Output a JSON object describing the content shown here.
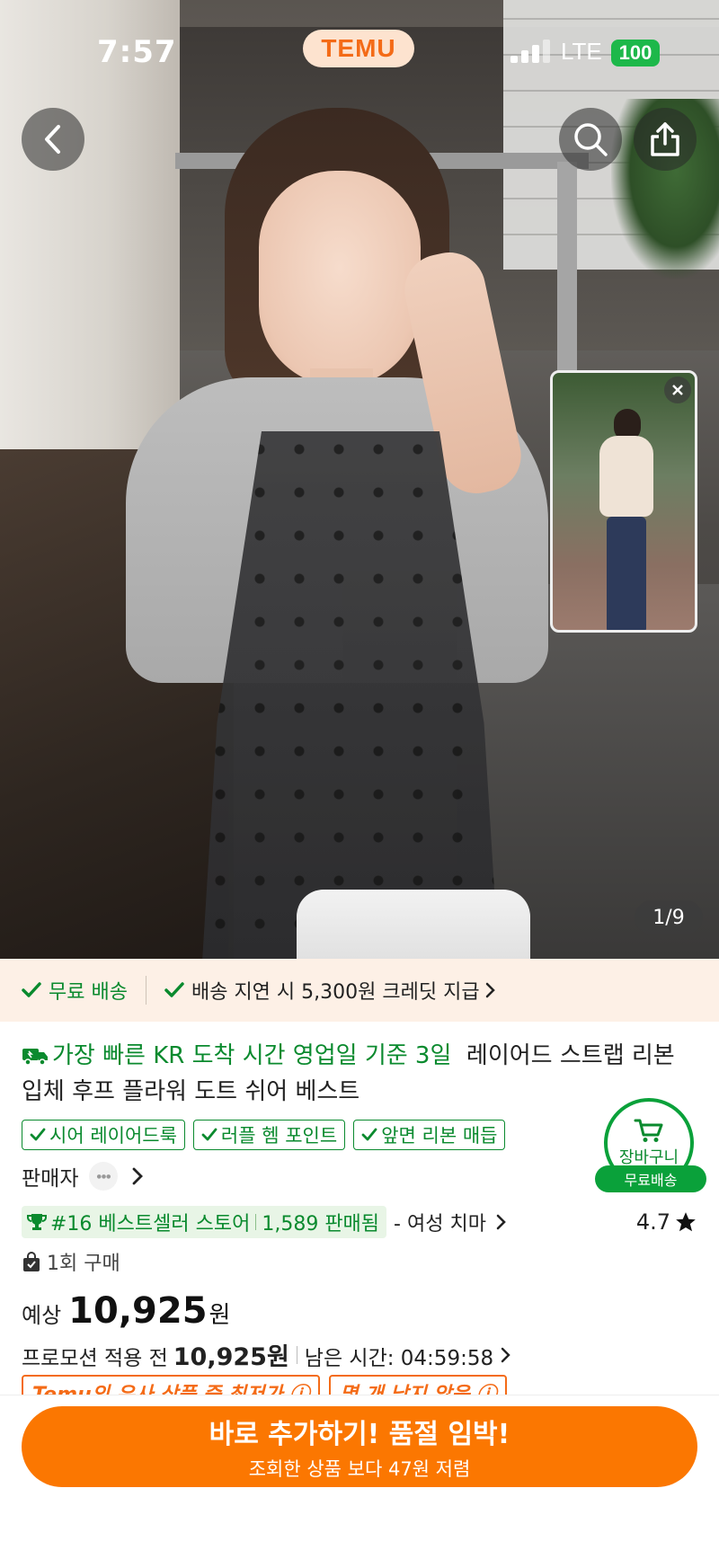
{
  "status": {
    "time": "7:57",
    "network": "LTE",
    "battery": "100"
  },
  "header": {
    "logo": "TEMU"
  },
  "gallery": {
    "counter": "1/9"
  },
  "shipping": {
    "free": "무료 배송",
    "credit": "배송 지연 시 5,300원 크레딧 지급"
  },
  "product": {
    "fast_label": "가장 빠른 KR 도착 시간 영업일 기준 3일",
    "title": "레이어드 스트랩 리본 입체 후프 플라워 도트 쉬어 베스트",
    "tags": [
      "시어 레이어드룩",
      "러플 헴 포인트",
      "앞면 리본 매듭"
    ]
  },
  "cart": {
    "label": "장바구니",
    "shipping": "무료배송"
  },
  "seller": {
    "label": "판매자"
  },
  "bestseller": {
    "rank": "#16 베스트셀러 스토어",
    "sold": "1,589 판매됨",
    "category": "- 여성 치마",
    "rating": "4.7"
  },
  "purchase": {
    "count": "1회 구매"
  },
  "price": {
    "prefix": "예상",
    "value": "10,925",
    "unit": "원",
    "promo_label": "프로모션 적용 전",
    "promo_value": "10,925원",
    "time_label": "남은 시간: 04:59:58"
  },
  "promo_tags": [
    "Temu의 유사 상품 중 최저가",
    "몇 개 남지 않음"
  ],
  "cta": {
    "main": "바로 추가하기! 품절 임박!",
    "sub": "조회한 상품 보다 47원 저렴"
  },
  "colors": {
    "accent": "#fb7701",
    "green": "#0a8a2e",
    "temu": "#f46b17"
  }
}
